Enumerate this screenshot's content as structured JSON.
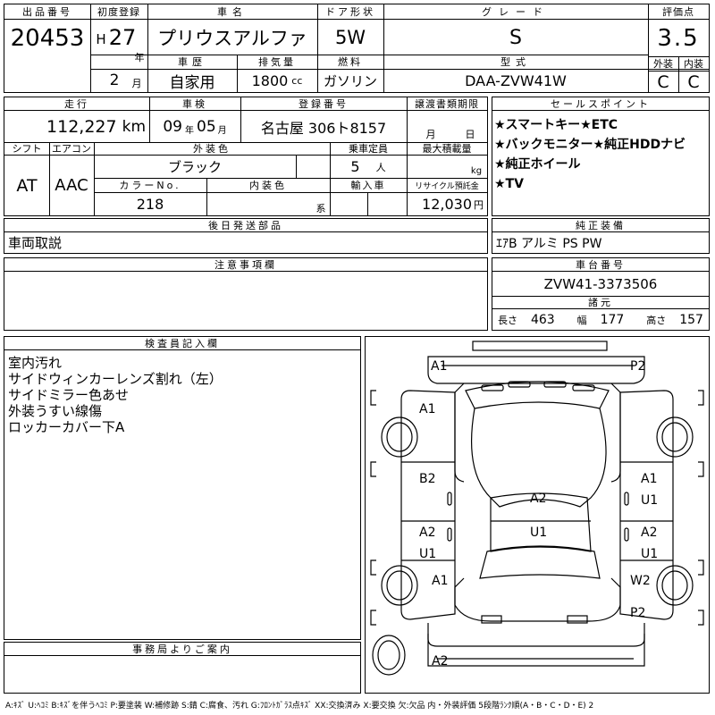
{
  "header": {
    "lot_no_label": "出品番号",
    "lot_no": "20453",
    "first_reg_label": "初度登録",
    "era_mark": "H",
    "year": "27",
    "year_unit": "年",
    "month": "2",
    "month_unit": "月",
    "car_name_label": "車名",
    "car_name": "プリウスアルファ",
    "door_label": "ドア形状",
    "door": "5W",
    "grade_label": "グレード",
    "grade": "S",
    "score_label": "評価点",
    "score": "3.5",
    "history_label": "車歴",
    "history": "自家用",
    "displacement_label": "排気量",
    "displacement": "1800",
    "displacement_unit": "cc",
    "fuel_label": "燃料",
    "fuel": "ガソリン",
    "model_label": "型式",
    "model": "DAA-ZVW41W",
    "exterior_label": "外装",
    "exterior_grade": "C",
    "interior_label": "内装",
    "interior_grade": "C"
  },
  "row2": {
    "mileage_label": "走行",
    "mileage": "112,227",
    "mileage_unit": "km",
    "inspection_label": "車検",
    "inspection_year": "09",
    "inspection_year_unit": "年",
    "inspection_month": "05",
    "inspection_month_unit": "月",
    "reg_no_label": "登録番号",
    "reg_no": "名古屋 306ト8157",
    "transfer_label": "譲渡書類期限",
    "transfer_month_unit": "月",
    "transfer_day_unit": "日",
    "shift_label": "シフト",
    "shift": "AT",
    "ac_label": "エアコン",
    "ac": "AAC",
    "color_label": "外装色",
    "color": "ブラック",
    "capacity_label": "乗車定員",
    "capacity": "5",
    "capacity_unit": "人",
    "load_label": "最大積載量",
    "load_unit": "kg",
    "color_no_label": "カラーNo.",
    "color_no": "218",
    "interior_color_label": "内装色",
    "interior_color_unit": "系",
    "import_label": "輸入車",
    "recycle_label": "リサイクル預託金",
    "recycle": "12,030",
    "recycle_unit": "円"
  },
  "sales_points": {
    "title": "セールスポイント",
    "lines": [
      "★スマートキー★ETC",
      "★バックモニター★純正HDDナビ",
      "★純正ホイール",
      "★TV"
    ]
  },
  "parts": {
    "title": "後日発送部品",
    "value": "車両取説"
  },
  "equipment": {
    "title": "純正装備",
    "value": "ｴｱB アルミ PS PW"
  },
  "notes": {
    "title": "注意事項欄"
  },
  "chassis": {
    "title": "車台番号",
    "value": "ZVW41-3373506"
  },
  "dimensions": {
    "title": "諸元",
    "length_label": "長さ",
    "length": "463",
    "width_label": "幅",
    "width": "177",
    "height_label": "高さ",
    "height": "157"
  },
  "inspector": {
    "title": "検査員記入欄",
    "lines": [
      "室内汚れ",
      "サイドウィンカーレンズ割れ（左）",
      "サイドミラー色あせ",
      "外装うすい線傷",
      "ロッカーカバー下A"
    ]
  },
  "office": {
    "title": "事務局よりご案内"
  },
  "diagram": {
    "marks": [
      "A1",
      "P2",
      "A1",
      "B2",
      "A2",
      "A1",
      "U1",
      "A2",
      "U1",
      "U1",
      "A2",
      "U1",
      "A1",
      "W2",
      "P2",
      "A2"
    ]
  },
  "legend": "A:ｷｽﾞ U:ﾍｺﾐ B:ｷｽﾞを伴うﾍｺﾐ P:要塗装 W:補修跡 S:錆 C:腐食、汚れ G:ﾌﾛﾝﾄｶﾞﾗｽ点ｷｽﾞ XX:交換済み X:要交換 欠:欠品 内・外装評価 5段階ﾗﾝｸ順(A・B・C・D・E) 2"
}
